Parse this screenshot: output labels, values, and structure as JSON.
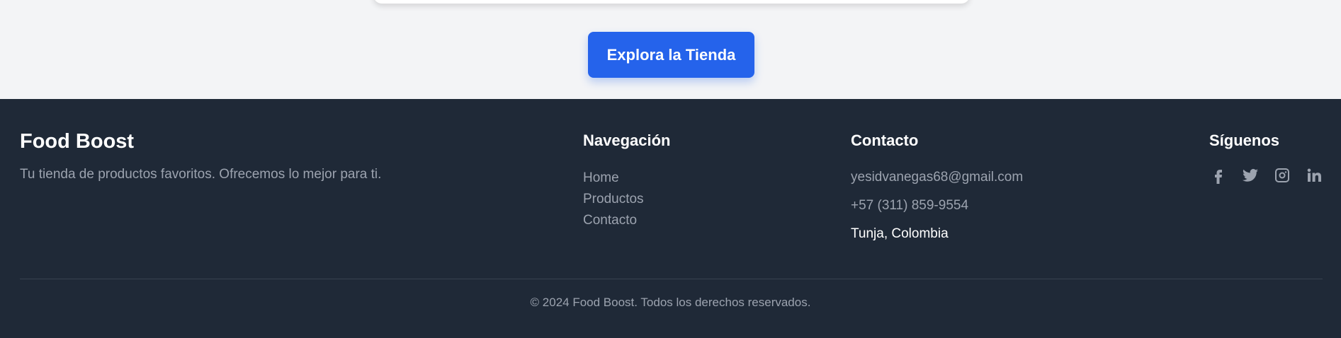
{
  "hero": {
    "cta_label": "Explora la Tienda"
  },
  "footer": {
    "brand": {
      "title": "Food Boost",
      "tagline": "Tu tienda de productos favoritos. Ofrecemos lo mejor para ti."
    },
    "navigation": {
      "title": "Navegación",
      "items": [
        "Home",
        "Productos",
        "Contacto"
      ]
    },
    "contact": {
      "title": "Contacto",
      "email": "yesidvanegas68@gmail.com",
      "phone": "+57 (311) 859-9554",
      "location": "Tunja, Colombia"
    },
    "social": {
      "title": "Síguenos",
      "icons": [
        "facebook-icon",
        "twitter-icon",
        "instagram-icon",
        "linkedin-icon"
      ]
    },
    "copyright": "© 2024 Food Boost. Todos los derechos reservados."
  },
  "colors": {
    "accent": "#2563eb",
    "footer_bg": "#1f2937",
    "page_bg": "#f3f4f6",
    "muted_text": "#9ca3af"
  }
}
